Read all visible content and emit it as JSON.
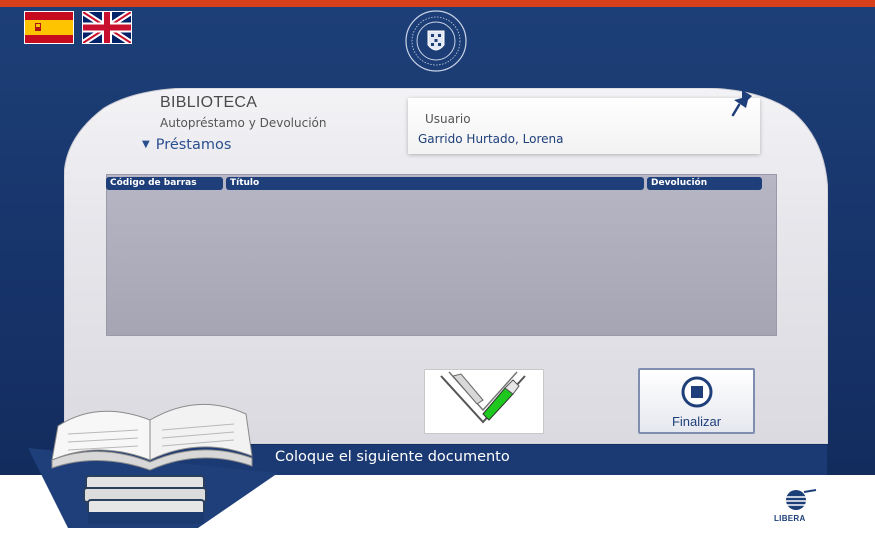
{
  "header": {
    "languages": [
      {
        "code": "es",
        "icon": "spain-flag-icon"
      },
      {
        "code": "en",
        "icon": "uk-flag-icon"
      }
    ],
    "logo": "university-seal-icon"
  },
  "panel": {
    "title": "BIBLIOTECA",
    "subtitle": "Autopréstamo y Devolución",
    "section": "Préstamos"
  },
  "user": {
    "label": "Usuario",
    "name": "Garrido Hurtado, Lorena",
    "pin_icon": "pushpin-icon"
  },
  "table": {
    "columns": [
      "Código de barras",
      "Título",
      "Devolución"
    ],
    "rows": []
  },
  "actions": {
    "finalize_label": "Finalizar",
    "finalize_icon": "stop-icon",
    "scanner_icon": "book-scanner-icon"
  },
  "status": {
    "message": "Coloque el siguiente documento"
  },
  "footer": {
    "brand": "LIBERA"
  },
  "colors": {
    "accent_top": "#d8401c",
    "background_blue": "#1d3f78",
    "header_cell": "#1f3f7a",
    "table_fill": "#adadbc"
  }
}
